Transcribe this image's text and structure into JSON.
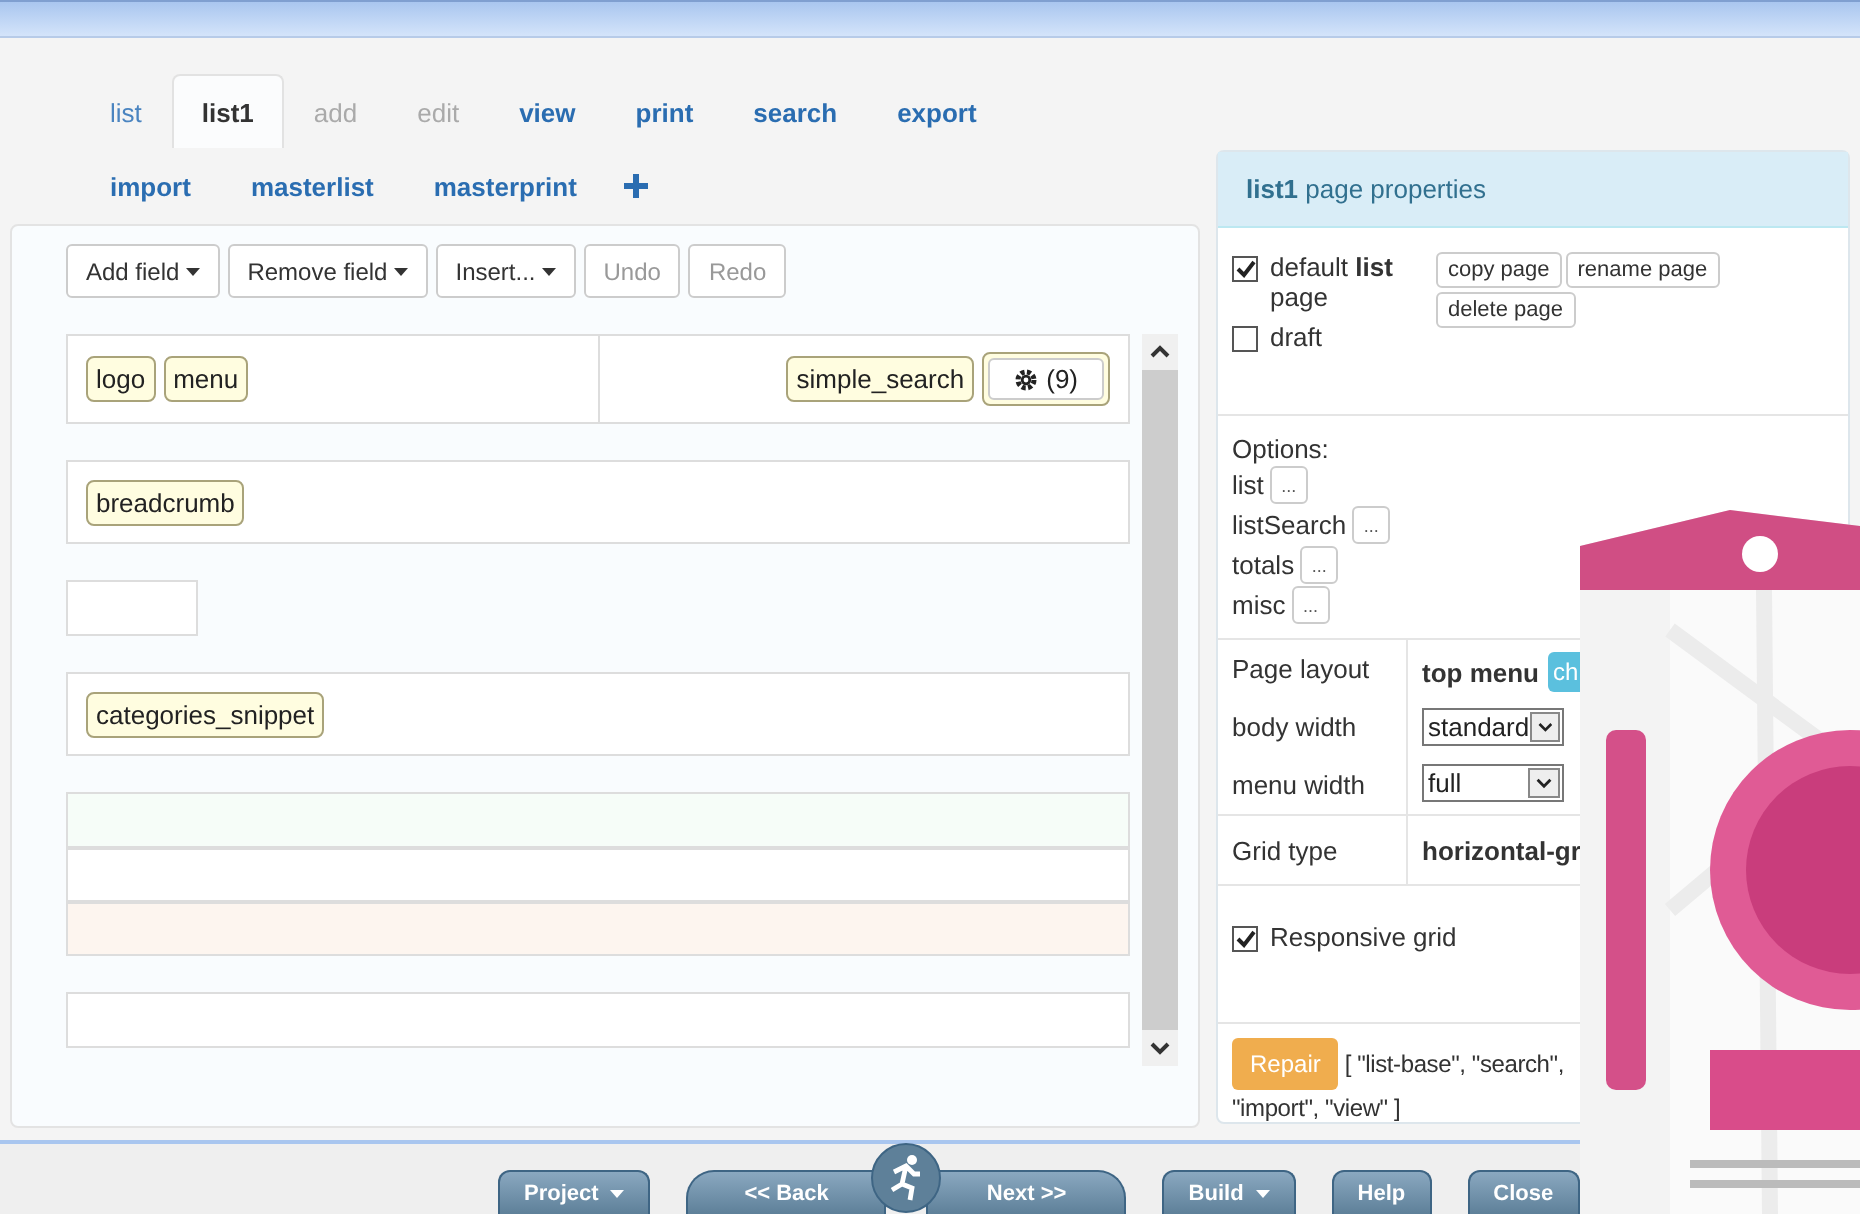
{
  "tabs": [
    {
      "label": "list",
      "selected": false,
      "disabled": false,
      "emphasis": false
    },
    {
      "label": "list1",
      "selected": true,
      "disabled": false,
      "emphasis": true
    },
    {
      "label": "add",
      "selected": false,
      "disabled": true,
      "emphasis": false
    },
    {
      "label": "edit",
      "selected": false,
      "disabled": true,
      "emphasis": false
    },
    {
      "label": "view",
      "selected": false,
      "disabled": false,
      "emphasis": true
    },
    {
      "label": "print",
      "selected": false,
      "disabled": false,
      "emphasis": true
    },
    {
      "label": "search",
      "selected": false,
      "disabled": false,
      "emphasis": true
    },
    {
      "label": "export",
      "selected": false,
      "disabled": false,
      "emphasis": true
    },
    {
      "label": "import",
      "selected": false,
      "disabled": false,
      "emphasis": true
    },
    {
      "label": "masterlist",
      "selected": false,
      "disabled": false,
      "emphasis": true
    },
    {
      "label": "masterprint",
      "selected": false,
      "disabled": false,
      "emphasis": true
    }
  ],
  "toolbar": [
    {
      "label": "Add field",
      "dropdown": true,
      "disabled": false
    },
    {
      "label": "Remove field",
      "dropdown": true,
      "disabled": false
    },
    {
      "label": "Insert...",
      "dropdown": true,
      "disabled": false
    },
    {
      "label": "Undo",
      "dropdown": false,
      "disabled": true
    },
    {
      "label": "Redo",
      "dropdown": false,
      "disabled": true
    }
  ],
  "canvas": {
    "header_left": [
      "logo",
      "menu"
    ],
    "header_right": [
      "simple_search"
    ],
    "settings_count": "(9)",
    "breadcrumb": "breadcrumb",
    "snippet": "categories_snippet"
  },
  "properties": {
    "title_page": "list1",
    "title_rest": "page properties",
    "checks": [
      {
        "label": "default **list** page",
        "checked": true
      },
      {
        "label": "draft",
        "checked": false
      }
    ],
    "page_buttons": [
      "copy page",
      "rename page",
      "delete page"
    ],
    "options_label": "Options:",
    "options": [
      "list",
      "listSearch",
      "totals",
      "misc"
    ],
    "options_button": "...",
    "layout_label": "Page layout",
    "layout_value": "top menu",
    "layout_button": "ch",
    "selects": [
      {
        "label": "body width",
        "value": "standard"
      },
      {
        "label": "menu width",
        "value": "full"
      }
    ],
    "grid_label": "Grid type",
    "grid_value": "horizontal-gr",
    "responsive": {
      "label": "Responsive grid",
      "checked": true
    },
    "repair": "Repair",
    "repair_lines": [
      "[ \"list-base\", \"search\",",
      "\"import\", \"view\" ]"
    ]
  },
  "bottom": [
    {
      "label": "Project",
      "kind": "dropdown"
    },
    {
      "label": "<< Back",
      "kind": "left"
    },
    {
      "label": "Next >>",
      "kind": "right"
    },
    {
      "label": "Build",
      "kind": "dropdown"
    },
    {
      "label": "Help",
      "kind": "plain"
    },
    {
      "label": "Close",
      "kind": "plain"
    }
  ]
}
